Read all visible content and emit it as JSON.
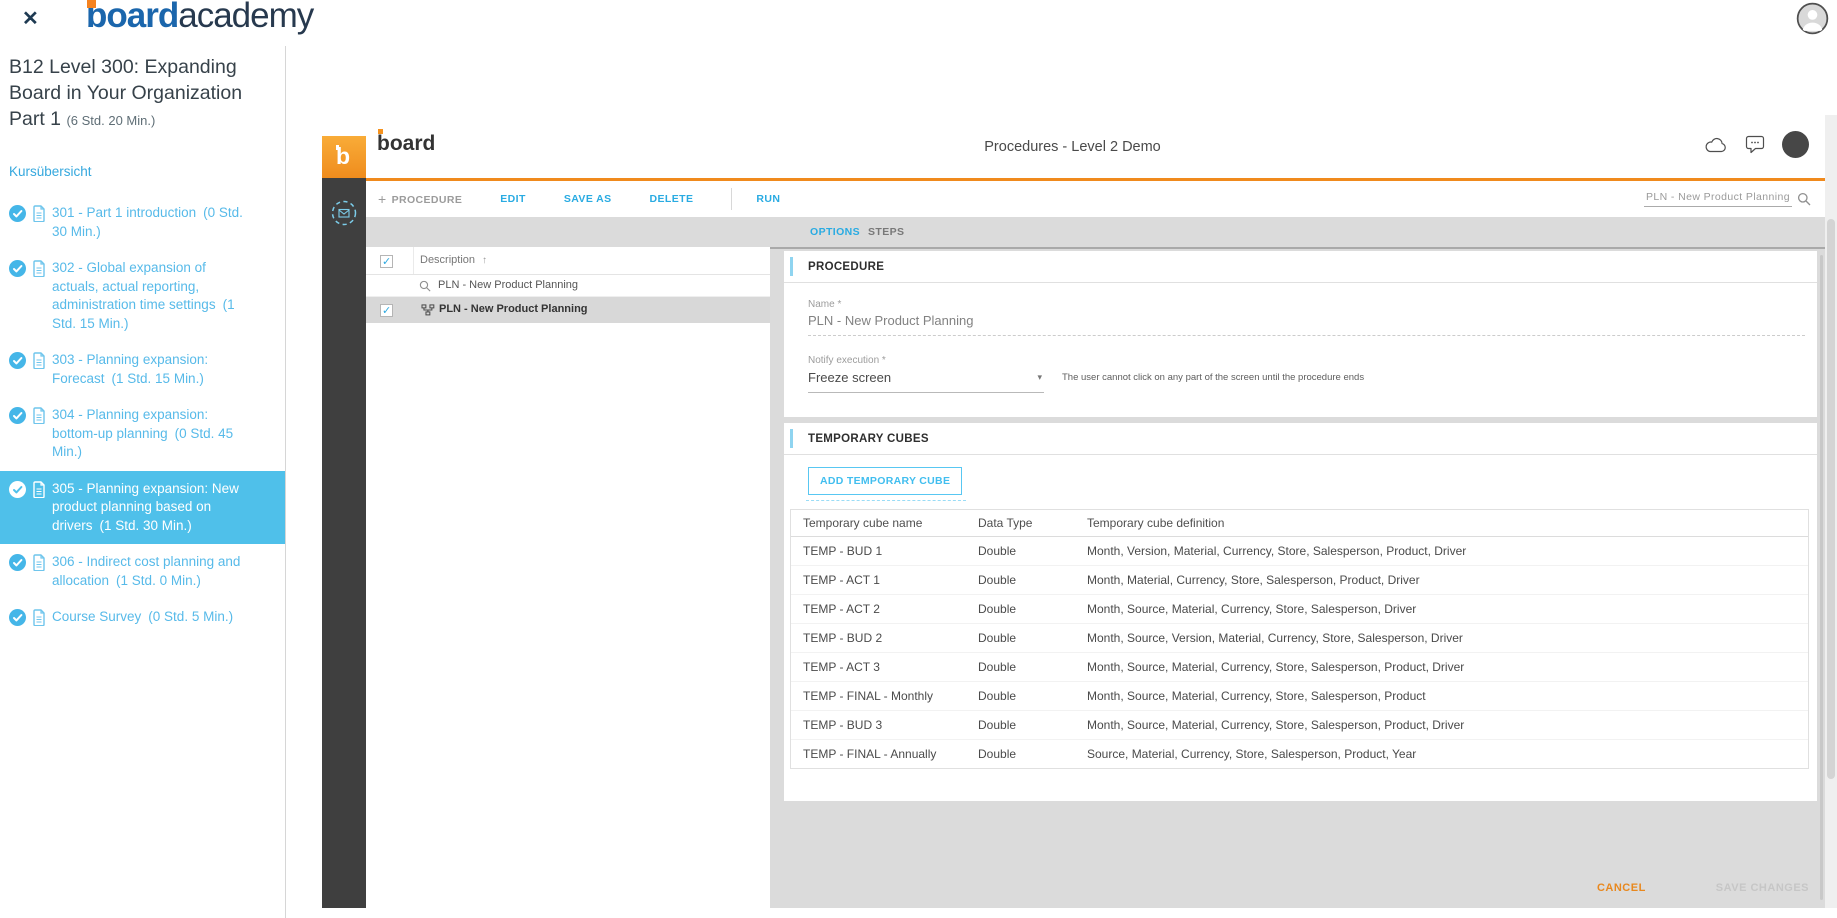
{
  "academy": {
    "close_icon": "✕",
    "logo": {
      "bold": "board",
      "light": "academy"
    },
    "course": {
      "title": "B12 Level 300: Expanding Board in Your Organization Part 1",
      "duration": "(6 Std. 20 Min.)",
      "overview_link": "Kursübersicht"
    },
    "items": [
      {
        "label": "301 - Part 1 introduction",
        "duration": "(0 Std. 30 Min.)",
        "completed": true,
        "active": false
      },
      {
        "label": "302 - Global expansion of actuals, actual reporting, administration time settings",
        "duration": "(1 Std. 15 Min.)",
        "completed": true,
        "active": false
      },
      {
        "label": "303 - Planning expansion: Forecast",
        "duration": "(1 Std. 15 Min.)",
        "completed": true,
        "active": false
      },
      {
        "label": "304 - Planning expansion: bottom-up planning",
        "duration": "(0 Std. 45 Min.)",
        "completed": true,
        "active": false
      },
      {
        "label": "305 - Planning expansion: New product planning based on drivers",
        "duration": "(1 Std. 30 Min.)",
        "completed": true,
        "active": true
      },
      {
        "label": "306 - Indirect cost planning and allocation",
        "duration": "(1 Std. 0 Min.)",
        "completed": true,
        "active": false
      },
      {
        "label": "Course Survey",
        "duration": "(0 Std. 5 Min.)",
        "completed": true,
        "active": false
      }
    ]
  },
  "app": {
    "header": {
      "logo_letter": "b",
      "wordmark": "board",
      "title": "Procedures - Level 2 Demo"
    },
    "toolbar": {
      "add_icon": "+",
      "new_procedure": "PROCEDURE",
      "edit": "EDIT",
      "save_as": "SAVE AS",
      "delete": "DELETE",
      "run": "RUN",
      "search_value": "PLN - New Product Planning"
    },
    "list": {
      "column_header": "Description",
      "sort_indicator": "↑",
      "search_value": "PLN - New Product Planning",
      "rows": [
        {
          "label": "PLN - New Product Planning",
          "checked": true,
          "selected": true
        }
      ]
    },
    "tabs": {
      "options": "OPTIONS",
      "steps": "STEPS"
    },
    "options_tab": {
      "procedure_section": {
        "header": "PROCEDURE",
        "name_label": "Name *",
        "name_value": "PLN - New Product Planning",
        "notify_label": "Notify execution *",
        "notify_value": "Freeze screen",
        "notify_caret": "▾",
        "notify_help": "The user cannot click on any part of the screen until the procedure ends"
      },
      "temporary_cubes_section": {
        "header": "TEMPORARY CUBES",
        "add_button": "ADD TEMPORARY CUBE",
        "table": {
          "headers": [
            "Temporary cube name",
            "Data Type",
            "Temporary cube definition"
          ],
          "rows": [
            {
              "name": "TEMP - BUD 1",
              "type": "Double",
              "definition": "Month, Version, Material, Currency, Store, Salesperson, Product, Driver"
            },
            {
              "name": "TEMP - ACT 1",
              "type": "Double",
              "definition": "Month, Material, Currency, Store, Salesperson, Product, Driver"
            },
            {
              "name": "TEMP - ACT 2",
              "type": "Double",
              "definition": "Month, Source, Material, Currency, Store, Salesperson, Driver"
            },
            {
              "name": "TEMP - BUD 2",
              "type": "Double",
              "definition": "Month, Source, Version, Material, Currency, Store, Salesperson, Driver"
            },
            {
              "name": "TEMP - ACT 3",
              "type": "Double",
              "definition": "Month, Source, Material, Currency, Store, Salesperson, Product, Driver"
            },
            {
              "name": "TEMP - FINAL - Monthly",
              "type": "Double",
              "definition": "Month, Source, Material, Currency, Store, Salesperson, Product"
            },
            {
              "name": "TEMP - BUD 3",
              "type": "Double",
              "definition": "Month, Source, Material, Currency, Store, Salesperson, Product, Driver"
            },
            {
              "name": "TEMP - FINAL - Annually",
              "type": "Double",
              "definition": "Source, Material, Currency, Store, Salesperson, Product, Year"
            }
          ]
        }
      },
      "footer": {
        "cancel": "CANCEL",
        "save": "SAVE CHANGES"
      }
    },
    "colors": {
      "accent_orange": "#F08A1D",
      "link_blue": "#29ABE2",
      "active_item_blue": "#4FC0EA",
      "cancel_orange": "#E8881E",
      "add_button_blue": "#4FC3F0"
    }
  }
}
